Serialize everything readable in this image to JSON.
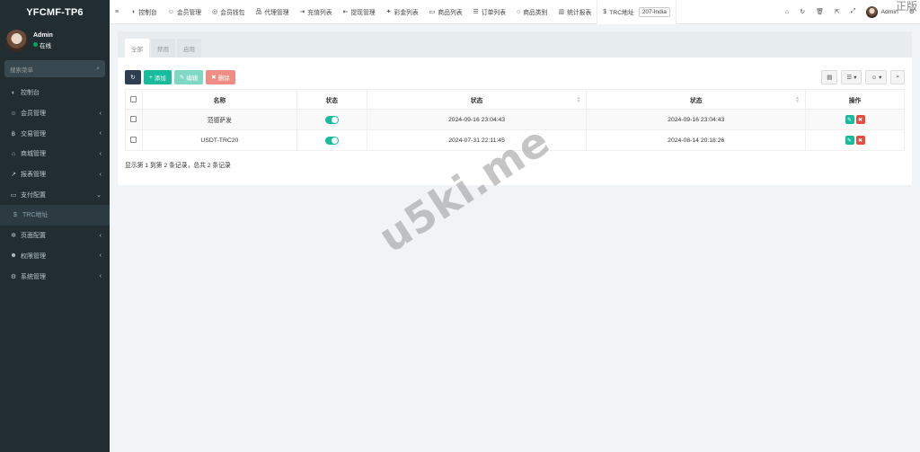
{
  "app": {
    "logo": "YFCMF-TP6"
  },
  "user": {
    "name": "Admin",
    "status": "在线"
  },
  "sidebar": {
    "search_placeholder": "搜索菜单",
    "items": [
      {
        "icon": "dashboard-icon",
        "glyph": "◐",
        "label": "控制台",
        "arrow": ""
      },
      {
        "icon": "user-circle-icon",
        "glyph": "☺",
        "label": "会员管理",
        "arrow": "‹"
      },
      {
        "icon": "bitcoin-icon",
        "glyph": "฿",
        "label": "交易管理",
        "arrow": "‹"
      },
      {
        "icon": "shop-icon",
        "glyph": "⌂",
        "label": "商城管理",
        "arrow": "‹"
      },
      {
        "icon": "line-chart-icon",
        "glyph": "↗",
        "label": "报表管理",
        "arrow": "‹"
      },
      {
        "icon": "credit-card-icon",
        "glyph": "▭",
        "label": "支付配置",
        "arrow": "⌄"
      },
      {
        "icon": "dollar-icon",
        "glyph": "$",
        "label": "TRC地址",
        "arrow": "",
        "sub": true
      },
      {
        "icon": "gear-icon",
        "glyph": "✲",
        "label": "页面配置",
        "arrow": "‹"
      },
      {
        "icon": "users-icon",
        "glyph": "☻",
        "label": "权限管理",
        "arrow": "‹"
      },
      {
        "icon": "cogs-icon",
        "glyph": "⚙",
        "label": "系统管理",
        "arrow": "‹"
      }
    ]
  },
  "topnav": {
    "items": [
      {
        "icon": "menu-toggle-icon",
        "glyph": "≡",
        "label": ""
      },
      {
        "icon": "dashboard-icon",
        "glyph": "◐",
        "label": "控制台"
      },
      {
        "icon": "user-icon",
        "glyph": "☺",
        "label": "会员管理"
      },
      {
        "icon": "wallet-icon",
        "glyph": "◎",
        "label": "会员钱包"
      },
      {
        "icon": "sitemap-icon",
        "glyph": "品",
        "label": "代理管理"
      },
      {
        "icon": "sign-in-icon",
        "glyph": "⇥",
        "label": "充值列表"
      },
      {
        "icon": "sign-out-icon",
        "glyph": "⇤",
        "label": "提现管理"
      },
      {
        "icon": "gift-icon",
        "glyph": "✦",
        "label": "彩金列表"
      },
      {
        "icon": "monitor-icon",
        "glyph": "▭",
        "label": "商品列表"
      },
      {
        "icon": "list-icon",
        "glyph": "☰",
        "label": "订单列表"
      },
      {
        "icon": "circle-icon",
        "glyph": "○",
        "label": "商品类别"
      },
      {
        "icon": "bar-chart-icon",
        "glyph": "▥",
        "label": "统计报表"
      }
    ],
    "active": {
      "icon": "dollar-icon",
      "glyph": "$",
      "label": "TRC地址",
      "badge": "207-India"
    },
    "right": [
      {
        "icon": "home-icon",
        "glyph": "⌂"
      },
      {
        "icon": "refresh-icon",
        "glyph": "↻"
      },
      {
        "icon": "trash-icon",
        "glyph": "🗑"
      },
      {
        "icon": "external-link-icon",
        "glyph": "⇱"
      },
      {
        "icon": "fullscreen-icon",
        "glyph": "⤢"
      }
    ],
    "user_name": "Admin",
    "corner_text": "正版"
  },
  "tabs": [
    "全部",
    "禁用",
    "启用"
  ],
  "toolbar": {
    "refresh_glyph": "↻",
    "add_label": "添加",
    "edit_label": "编辑",
    "delete_label": "删除",
    "columns_glyph": "▤",
    "export_glyph": "☰",
    "user_glyph": "☺",
    "search_glyph": "⌕"
  },
  "table": {
    "headers": [
      "名称",
      "状态",
      "状态",
      "状态",
      "操作"
    ],
    "rows": [
      {
        "name": "范德萨发",
        "created": "2024-09-16 23:04:43",
        "updated": "2024-09-16 23:04:43"
      },
      {
        "name": "USDT-TRC20",
        "created": "2024-07-31 22:11:45",
        "updated": "2024-08-14 20:18:26"
      }
    ]
  },
  "pagination": {
    "info": "显示第 1 到第 2 条记录，总共 2 条记录"
  },
  "watermark": "u5ki.me"
}
